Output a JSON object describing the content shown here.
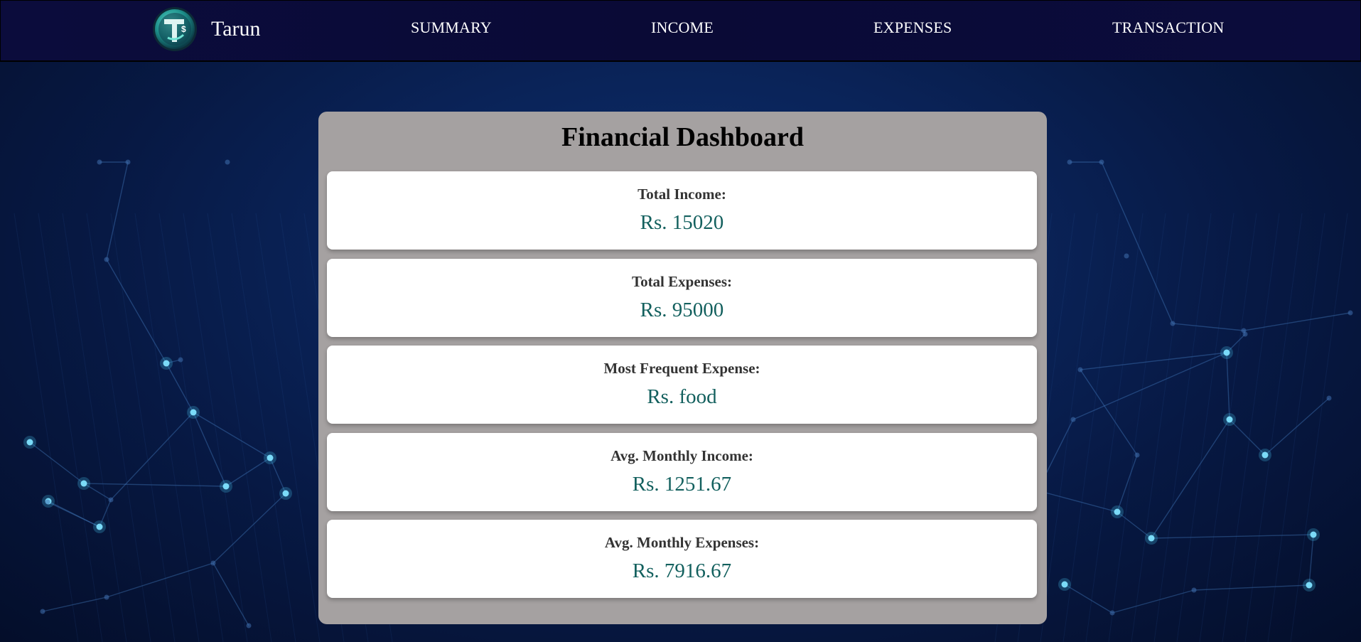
{
  "brand": {
    "name": "Tarun",
    "logo_icon": "tarun-dollar-logo-icon"
  },
  "nav": {
    "items": [
      {
        "label": "SUMMARY"
      },
      {
        "label": "INCOME"
      },
      {
        "label": "EXPENSES"
      },
      {
        "label": "TRANSACTION"
      }
    ]
  },
  "dashboard": {
    "title": "Financial Dashboard",
    "cards": [
      {
        "label": "Total Income:",
        "value": "Rs. 15020"
      },
      {
        "label": "Total Expenses:",
        "value": "Rs. 95000"
      },
      {
        "label": "Most Frequent Expense:",
        "value": "Rs. food"
      },
      {
        "label": "Avg. Monthly Income:",
        "value": "Rs. 1251.67"
      },
      {
        "label": "Avg. Monthly Expenses:",
        "value": "Rs. 7916.67"
      }
    ]
  },
  "colors": {
    "navbar": "#0b0c3c",
    "panel": "#a5a1a1",
    "value_text": "#13605e",
    "background": "#0a2358"
  }
}
